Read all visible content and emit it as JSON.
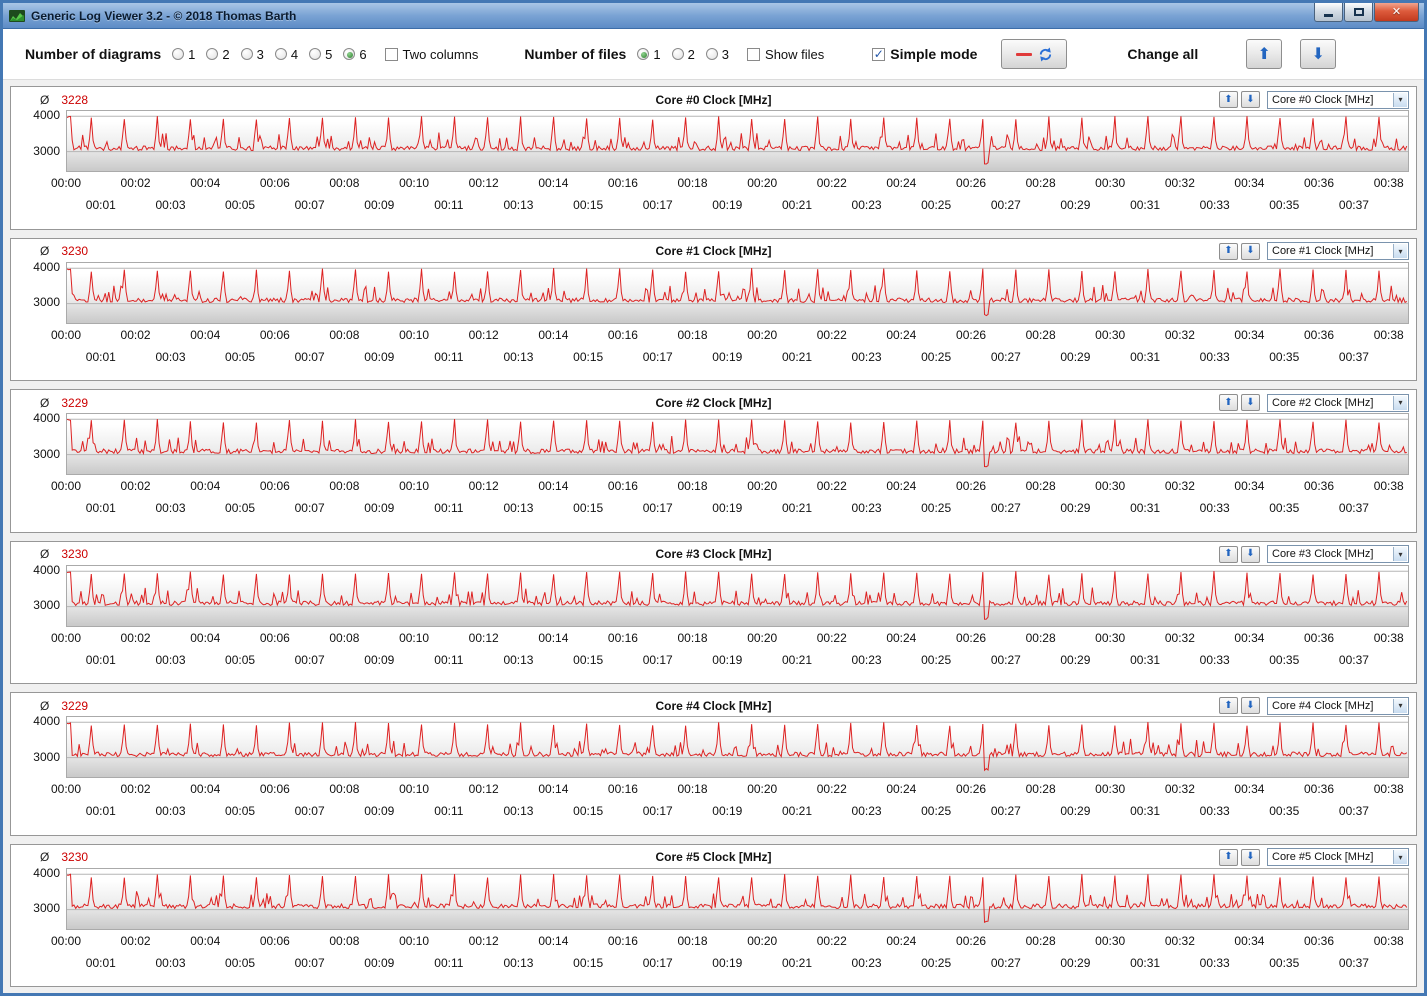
{
  "window": {
    "title": "Generic Log Viewer 3.2 - © 2018 Thomas Barth"
  },
  "icons": {
    "up_arrow": "⬆",
    "down_arrow": "⬇",
    "dropdown_arrow": "▾",
    "check_mark": "✓",
    "close": "✕"
  },
  "toolbar": {
    "diagrams": {
      "label": "Number of diagrams",
      "options": [
        "1",
        "2",
        "3",
        "4",
        "5",
        "6"
      ],
      "selected": "6"
    },
    "two_columns": {
      "label": "Two columns",
      "checked": false
    },
    "files": {
      "label": "Number of files",
      "options": [
        "1",
        "2",
        "3"
      ],
      "selected": "1"
    },
    "show_files": {
      "label": "Show files",
      "checked": false
    },
    "simple_mode": {
      "label": "Simple mode",
      "checked": true
    },
    "change_all_label": "Change all"
  },
  "chart_data": {
    "type": "line",
    "avg_symbol": "Ø",
    "series_color": "#dd2222",
    "grid_color": "#b5b5b5",
    "y_ticks": [
      "4000",
      "3000"
    ],
    "y_tick_values": [
      4000,
      3000
    ],
    "ylim": [
      2450,
      4150
    ],
    "x_unit": "mm:ss",
    "x_ticks": [
      "00:00",
      "00:01",
      "00:02",
      "00:03",
      "00:04",
      "00:05",
      "00:06",
      "00:07",
      "00:08",
      "00:09",
      "00:10",
      "00:11",
      "00:12",
      "00:13",
      "00:14",
      "00:15",
      "00:16",
      "00:17",
      "00:18",
      "00:19",
      "00:20",
      "00:21",
      "00:22",
      "00:23",
      "00:24",
      "00:25",
      "00:26",
      "00:27",
      "00:28",
      "00:29",
      "00:30",
      "00:31",
      "00:32",
      "00:33",
      "00:34",
      "00:35",
      "00:36",
      "00:37",
      "00:38"
    ],
    "waveform": {
      "description": "Periodic CPU clock trace: baseline ~3030 MHz with noise, spikes to ~3960 MHz about every 57 s, starts at ~4000 MHz, single dip to ~2640 MHz near 00:26:30",
      "baseline": 3030,
      "noise": 130,
      "spike_value": 3960,
      "period_seconds": 57,
      "duration_seconds": 2315,
      "dip_time_seconds": 1588,
      "dip_value": 2640
    },
    "charts": [
      {
        "title": "Core #0 Clock [MHz]",
        "average": "3228",
        "dropdown_value": "Core #0 Clock [MHz]"
      },
      {
        "title": "Core #1 Clock [MHz]",
        "average": "3230",
        "dropdown_value": "Core #1 Clock [MHz]"
      },
      {
        "title": "Core #2 Clock [MHz]",
        "average": "3229",
        "dropdown_value": "Core #2 Clock [MHz]"
      },
      {
        "title": "Core #3 Clock [MHz]",
        "average": "3230",
        "dropdown_value": "Core #3 Clock [MHz]"
      },
      {
        "title": "Core #4 Clock [MHz]",
        "average": "3229",
        "dropdown_value": "Core #4 Clock [MHz]"
      },
      {
        "title": "Core #5 Clock [MHz]",
        "average": "3230",
        "dropdown_value": "Core #5 Clock [MHz]"
      }
    ]
  }
}
